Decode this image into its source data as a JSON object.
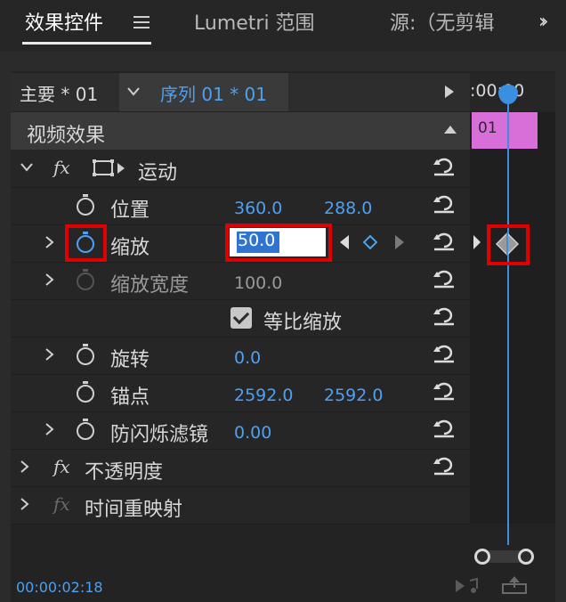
{
  "tabs": [
    {
      "label": "效果控件",
      "active": true
    },
    {
      "label": "Lumetri 范围",
      "active": false
    },
    {
      "label": "源:（无剪辑",
      "active": false
    }
  ],
  "header": {
    "master_label": "主要 * 01",
    "sequence_label": "序列 01 * 01",
    "timeline_time": ":00:00"
  },
  "timeline": {
    "clip_label": "01",
    "clip_color": "#d86ed8"
  },
  "section": {
    "title": "视频效果"
  },
  "properties": {
    "motion": {
      "label": "运动"
    },
    "position": {
      "label": "位置",
      "x": "360.0",
      "y": "288.0"
    },
    "scale": {
      "label": "缩放",
      "value": "50.0"
    },
    "scale_width": {
      "label": "缩放宽度",
      "value": "100.0"
    },
    "uniform_scale": {
      "label": "等比缩放",
      "checked": true
    },
    "rotation": {
      "label": "旋转",
      "value": "0.0"
    },
    "anchor": {
      "label": "锚点",
      "x": "2592.0",
      "y": "2592.0"
    },
    "anti_flicker": {
      "label": "防闪烁滤镜",
      "value": "0.00"
    },
    "opacity": {
      "label": "不透明度"
    },
    "time_remap": {
      "label": "时间重映射"
    }
  },
  "footer": {
    "timecode": "00:00:02:18"
  },
  "colors": {
    "accent": "#4ea0f2",
    "highlight": "#e00000",
    "clip": "#d86ed8"
  }
}
